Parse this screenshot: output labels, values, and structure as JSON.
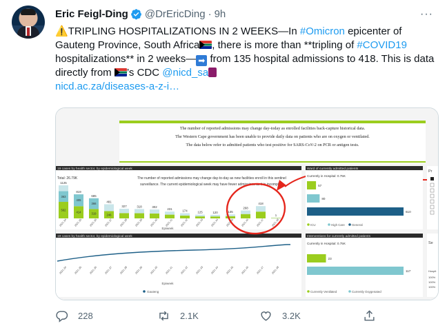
{
  "tweet": {
    "author_name": "Eric Feigl-Ding",
    "handle": "@DrEricDing",
    "separator": "·",
    "time": "9h",
    "more_label": "···",
    "text": {
      "warning_emoji": "⚠️",
      "p1": "TRIPLING HOSPITALIZATIONS IN 2 WEEKS—In ",
      "hashtag1": "#Omicron",
      "p2": " epicenter of Gauteng Province, South Africa",
      "p3": ", there is more than **tripling of ",
      "hashtag2": "#COVID19",
      "p4": " hospitalizations** in 2 weeks—",
      "arrow": "➡",
      "p5": " from 135 hospital admissions to 418. This is data directly from ",
      "p6": "’s CDC ",
      "mention": "@nicd_sa",
      "link": "nicd.ac.za/diseases-a-z-i…"
    },
    "media": {
      "banner_lines": [
        "The number of reported admissions may change day-today as enrolled facilities back-capture historical data.",
        "The Western Cape government has been unable to provide daily data on patients who are on oxygen or ventilated.",
        "The data below refer to admitted patients who test positive for SARS-CoV-2 on PCR or antigen tests."
      ],
      "left_top_title": "19 cases by health sector, by epidemiological week",
      "total_label": "Total: 26.79K",
      "note_lines": [
        "The number of reported admissions may change day-to-day as new facilities enroll in this sentinel",
        "surveillance. The current epidemiological week may have fewer admissions as it is incomplete"
      ],
      "bar_totals": [
        "1125",
        "819",
        "685",
        "481",
        "327",
        "318",
        "302",
        "231",
        "174",
        "125",
        "120",
        "135",
        "268",
        "418",
        "1"
      ],
      "bar_seg_a": [
        "363",
        "405",
        "366",
        "",
        "",
        "",
        "",
        "",
        "",
        "",
        "",
        "",
        "",
        "",
        ""
      ],
      "bar_seg_b": [
        "562",
        "414",
        "319",
        "246",
        "",
        "",
        "",
        "",
        "",
        "",
        "",
        "",
        "",
        "",
        ""
      ],
      "week_labels": [
        "2021.34",
        "2021.35",
        "2021.36",
        "2021.37",
        "2021.38",
        "2021.39",
        "2021.40",
        "2021.41",
        "2021.42",
        "2021.43",
        "2021.44",
        "2021.45",
        "2021.46",
        "2021.47",
        "2021.48"
      ],
      "x_axis_title": "Epiweek",
      "left_bottom_title": "ssions by province, by epidemiological week",
      "bottom_week_labels": [
        "2021.34",
        "2021.35",
        "2021.36",
        "2021.37",
        "2021.38",
        "2021.39",
        "2021.40",
        "2021.41",
        "2021.42",
        "2021.43",
        "2021.44",
        "2021.45",
        "2021.46",
        "2021.47",
        "2021.48"
      ],
      "bottom_axis_title": "Epiweek",
      "bottom_legend": "Gauteng",
      "right_top_title": "Ward of currently admitted patients",
      "currently_label": "Currently in Hospital:  0.75K",
      "ward_values": [
        "57",
        "80",
        "610"
      ],
      "ward_legend": [
        "ICU",
        "High Care",
        "General"
      ],
      "right_bottom_title": "Interventions for currently admitted patients",
      "currently_label_2": "Currently in Hospital:  0.75K",
      "interv_values": [
        "23",
        "117"
      ],
      "interv_legend": [
        "Currently Ventilated",
        "Currently Oxygenated"
      ],
      "side_tab_1": "Pr",
      "side_tab_2": "Se",
      "side_tab_3": "Hospit",
      "side_pct": [
        "100%",
        "100%",
        "100%"
      ]
    },
    "actions": {
      "replies": "228",
      "retweets": "2.1K",
      "likes": "3.2K"
    },
    "colors": {
      "accent": "#1d9bf0",
      "lime": "#9bcd1e",
      "teal": "#7fc7cf",
      "navy": "#1d5f87",
      "annotation_red": "#e5261c"
    }
  }
}
